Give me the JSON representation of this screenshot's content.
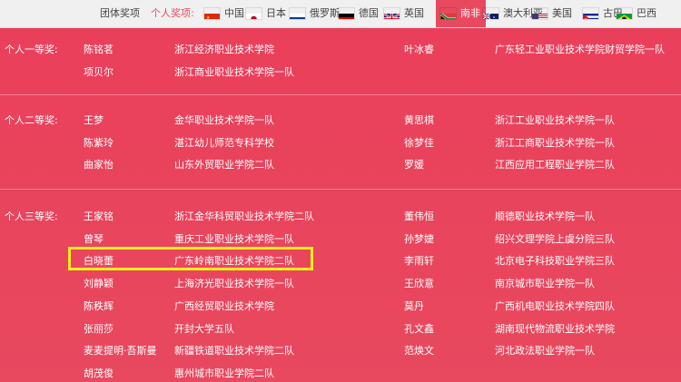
{
  "nav": {
    "team_awards": "团体奖项",
    "individual_awards": "个人奖项:",
    "countries": [
      {
        "label": "中国",
        "icon": "china-flag-icon"
      },
      {
        "label": "日本",
        "icon": "japan-flag-icon"
      },
      {
        "label": "俄罗斯",
        "icon": "russia-flag-icon"
      },
      {
        "label": "德国",
        "icon": "germany-flag-icon"
      },
      {
        "label": "英国",
        "icon": "uk-flag-icon"
      },
      {
        "label": "南非",
        "icon": "south-africa-flag-icon",
        "active": true
      },
      {
        "label": "澳大利亚",
        "icon": "australia-flag-icon"
      },
      {
        "label": "美国",
        "icon": "usa-flag-icon"
      },
      {
        "label": "古巴",
        "icon": "cuba-flag-icon"
      },
      {
        "label": "巴西",
        "icon": "brazil-flag-icon"
      }
    ]
  },
  "awards": {
    "first": {
      "title": "个人一等奖:",
      "left": [
        {
          "name": "陈铭茗",
          "school": "浙江经济职业技术学院"
        },
        {
          "name": "项贝尔",
          "school": "浙江商业职业技术学院一队"
        }
      ],
      "right": [
        {
          "name": "叶冰睿",
          "school": "广东轻工业职业技术学院财贸学院一队"
        }
      ]
    },
    "second": {
      "title": "个人二等奖:",
      "left": [
        {
          "name": "王梦",
          "school": "金华职业技术学院一队"
        },
        {
          "name": "陈紫玲",
          "school": "湛江幼儿师范专科学校"
        },
        {
          "name": "曲家怡",
          "school": "山东外贸职业学院二队"
        }
      ],
      "right": [
        {
          "name": "黄思棋",
          "school": "浙江工业职业技术学院一队"
        },
        {
          "name": "徐梦佳",
          "school": "浙江工商职业技术学院一队"
        },
        {
          "name": "罗媛",
          "school": "江西应用工程职业学院二队"
        }
      ]
    },
    "third": {
      "title": "个人三等奖:",
      "left": [
        {
          "name": "王家铭",
          "school": "浙江金华科贸职业技术学院二队"
        },
        {
          "name": "曾琴",
          "school": "重庆工业职业技术学院一队"
        },
        {
          "name": "白晓蕾",
          "school": "广东岭南职业技术学院二队"
        },
        {
          "name": "刘静颖",
          "school": "上海济光职业技术学院一队"
        },
        {
          "name": "陈秩辉",
          "school": "广西经贸职业技术学院"
        },
        {
          "name": "张丽莎",
          "school": "开封大学五队"
        },
        {
          "name": "麦麦提明·吾斯曼",
          "school": "新疆铁道职业技术学院二队"
        },
        {
          "name": "胡茂俊",
          "school": "惠州城市职业学院二队"
        }
      ],
      "right": [
        {
          "name": "董伟恒",
          "school": "顺德职业技术学院一队"
        },
        {
          "name": "孙梦婕",
          "school": "绍兴文理学院上虞分院三队"
        },
        {
          "name": "李雨轩",
          "school": "北京电子科技职业学院三队"
        },
        {
          "name": "王欣意",
          "school": "南京城市职业学院一队"
        },
        {
          "name": "莫丹",
          "school": "广西机电职业技术学院四队"
        },
        {
          "name": "孔文鑫",
          "school": "湖南现代物流职业技术学院"
        },
        {
          "name": "范焕文",
          "school": "河北政法职业学院一队"
        }
      ]
    }
  },
  "colors": {
    "background": "#e8495f",
    "highlight": "#f2ef1b",
    "topbar": "#f0f0f0"
  }
}
